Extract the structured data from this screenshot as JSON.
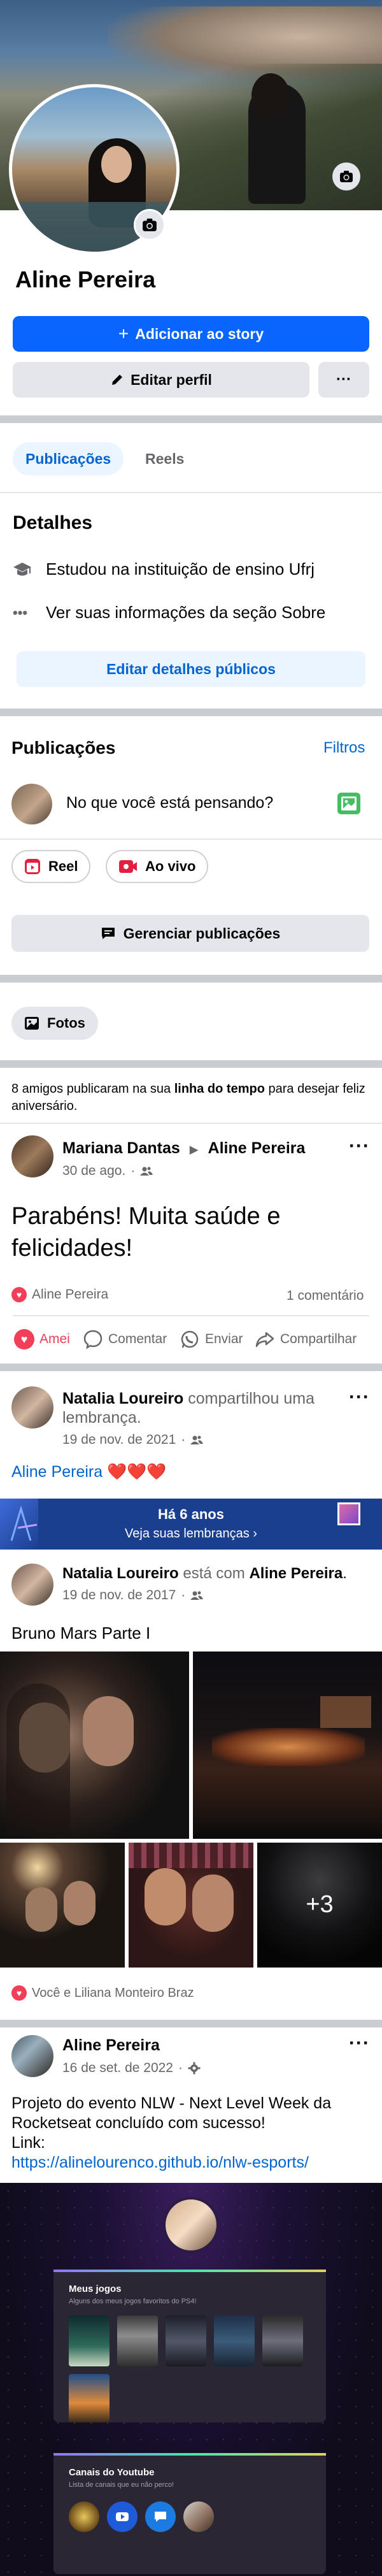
{
  "profile": {
    "name": "Aline Pereira",
    "add_story": "Adicionar ao story",
    "edit_profile": "Editar perfil",
    "more": "···"
  },
  "tabs": [
    {
      "label": "Publicações"
    },
    {
      "label": "Reels"
    }
  ],
  "details": {
    "title": "Detalhes",
    "items": [
      {
        "icon": "graduation-cap-icon",
        "text": "Estudou na instituição de ensino Ufrj"
      },
      {
        "icon": "more-dots-icon",
        "text": "Ver suas informações da seção Sobre"
      }
    ],
    "edit_button": "Editar detalhes públicos"
  },
  "posts_section": {
    "title": "Publicações",
    "filters": "Filtros",
    "composer_placeholder": "No que você está pensando?",
    "reel": "Reel",
    "live": "Ao vivo",
    "manage": "Gerenciar publicações",
    "photos": "Fotos"
  },
  "birthday_notice": {
    "text_before": "8 amigos publicaram na sua ",
    "bold": "linha do tempo",
    "text_after": " para desejar feliz aniversário."
  },
  "post1": {
    "author": "Mariana Dantas",
    "arrow": "▶",
    "target": "Aline Pereira",
    "date": "30 de ago.",
    "text": "Parabéns! Muita saúde e felicidades!",
    "reactor": "Aline Pereira",
    "comments": "1 comentário",
    "actions": [
      "Amei",
      "Comentar",
      "Enviar",
      "Compartilhar"
    ]
  },
  "memory": {
    "author": "Natalia Loureiro",
    "action": " compartilhou uma lembrança.",
    "date": "19 de nov. de 2021",
    "caption": "Aline Pereira ❤️❤️❤️",
    "banner_title": "Há 6 anos",
    "banner_link": "Veja suas lembranças ›"
  },
  "memory_post": {
    "author": "Natalia Loureiro",
    "with": " está com ",
    "target": "Aline Pereira",
    "dot": ".",
    "date": "19 de nov. de 2017",
    "text": "Bruno Mars Parte I",
    "more_photos": "+3",
    "reactors": "Você e Liliana Monteiro Braz"
  },
  "post3": {
    "author": "Aline Pereira",
    "date": "16 de set. de 2022",
    "line1": "Projeto do evento NLW - Next Level Week da Rocketseat concluído com sucesso!",
    "line2": "Link:",
    "link": "https://alinelourenco.github.io/nlw-esports/",
    "games_title": "Meus jogos",
    "games_sub": "Alguns dos meus jogos favoritos do PS4!",
    "yt_title": "Canais do Youtube",
    "yt_sub": "Lista de canais que eu não perco!"
  },
  "colors": {
    "blue": "#0866ff",
    "heart": "#f33e58",
    "link": "#0064d1"
  }
}
